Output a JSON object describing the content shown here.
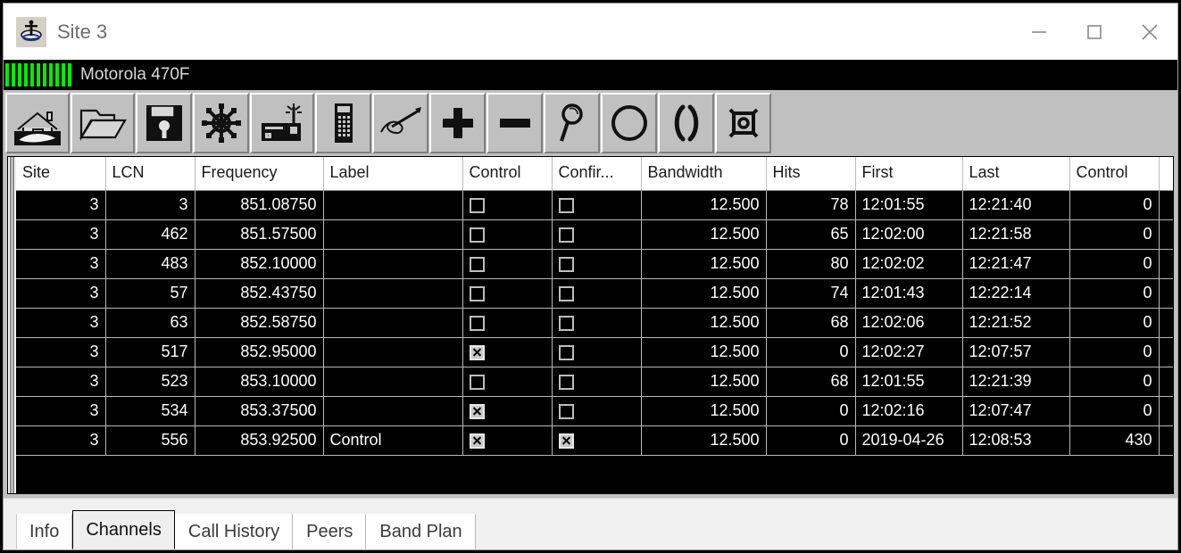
{
  "window": {
    "title": "Site 3",
    "app_icon": "antenna-site-icon",
    "controls": {
      "minimize": "minimize-icon",
      "maximize": "maximize-icon",
      "close": "close-icon"
    }
  },
  "status": {
    "radio_model": "Motorola 470F",
    "signal_bars": 11,
    "signal_color": "#00ee00"
  },
  "toolbar": {
    "buttons": [
      {
        "name": "home-icon",
        "label": "Home"
      },
      {
        "name": "open-folder-icon",
        "label": "Open"
      },
      {
        "name": "save-disk-icon",
        "label": "Save"
      },
      {
        "name": "ships-wheel-icon",
        "label": "Navigate"
      },
      {
        "name": "scanner-radio-icon",
        "label": "Radio"
      },
      {
        "name": "handheld-radio-icon",
        "label": "Handheld"
      },
      {
        "name": "signature-pen-icon",
        "label": "Sign"
      },
      {
        "name": "plus-icon",
        "label": "Add"
      },
      {
        "name": "minus-icon",
        "label": "Remove"
      },
      {
        "name": "magnifier-icon",
        "label": "Search"
      },
      {
        "name": "circle-icon",
        "label": "Record"
      },
      {
        "name": "parentheses-icon",
        "label": "Transmit"
      },
      {
        "name": "box-node-icon",
        "label": "Node"
      }
    ]
  },
  "grid": {
    "columns": [
      "Site",
      "LCN",
      "Frequency",
      "Label",
      "Control",
      "Confir...",
      "Bandwidth",
      "Hits",
      "First",
      "Last",
      "Control"
    ],
    "rows": [
      {
        "site": "3",
        "lcn": "3",
        "frequency": "851.08750",
        "label": "",
        "control": false,
        "confirmed": false,
        "bandwidth": "12.500",
        "hits": "78",
        "first": "12:01:55",
        "last": "12:21:40",
        "control2": "0"
      },
      {
        "site": "3",
        "lcn": "462",
        "frequency": "851.57500",
        "label": "",
        "control": false,
        "confirmed": false,
        "bandwidth": "12.500",
        "hits": "65",
        "first": "12:02:00",
        "last": "12:21:58",
        "control2": "0"
      },
      {
        "site": "3",
        "lcn": "483",
        "frequency": "852.10000",
        "label": "",
        "control": false,
        "confirmed": false,
        "bandwidth": "12.500",
        "hits": "80",
        "first": "12:02:02",
        "last": "12:21:47",
        "control2": "0"
      },
      {
        "site": "3",
        "lcn": "57",
        "frequency": "852.43750",
        "label": "",
        "control": false,
        "confirmed": false,
        "bandwidth": "12.500",
        "hits": "74",
        "first": "12:01:43",
        "last": "12:22:14",
        "control2": "0"
      },
      {
        "site": "3",
        "lcn": "63",
        "frequency": "852.58750",
        "label": "",
        "control": false,
        "confirmed": false,
        "bandwidth": "12.500",
        "hits": "68",
        "first": "12:02:06",
        "last": "12:21:52",
        "control2": "0"
      },
      {
        "site": "3",
        "lcn": "517",
        "frequency": "852.95000",
        "label": "",
        "control": true,
        "confirmed": false,
        "bandwidth": "12.500",
        "hits": "0",
        "first": "12:02:27",
        "last": "12:07:57",
        "control2": "0"
      },
      {
        "site": "3",
        "lcn": "523",
        "frequency": "853.10000",
        "label": "",
        "control": false,
        "confirmed": false,
        "bandwidth": "12.500",
        "hits": "68",
        "first": "12:01:55",
        "last": "12:21:39",
        "control2": "0"
      },
      {
        "site": "3",
        "lcn": "534",
        "frequency": "853.37500",
        "label": "",
        "control": true,
        "confirmed": false,
        "bandwidth": "12.500",
        "hits": "0",
        "first": "12:02:16",
        "last": "12:07:47",
        "control2": "0"
      },
      {
        "site": "3",
        "lcn": "556",
        "frequency": "853.92500",
        "label": "Control",
        "control": true,
        "confirmed": true,
        "bandwidth": "12.500",
        "hits": "0",
        "first": "2019-04-26",
        "last": "12:08:53",
        "control2": "430"
      }
    ]
  },
  "tabs": {
    "items": [
      {
        "label": "Info",
        "selected": false
      },
      {
        "label": "Channels",
        "selected": true
      },
      {
        "label": "Call History",
        "selected": false
      },
      {
        "label": "Peers",
        "selected": false
      },
      {
        "label": "Band Plan",
        "selected": false
      }
    ]
  }
}
